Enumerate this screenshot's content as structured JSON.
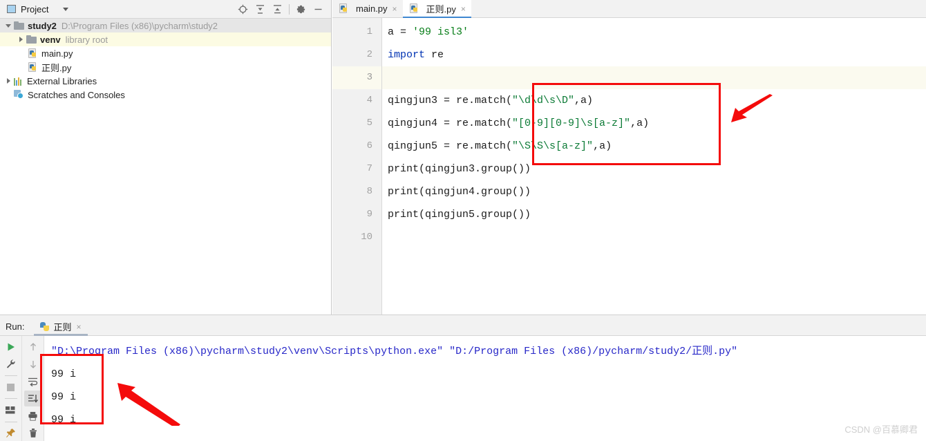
{
  "project_panel": {
    "title": "Project",
    "dropdown_icon": "chevron-down-icon",
    "tools": [
      {
        "name": "locate-icon",
        "label": "⊕"
      },
      {
        "name": "expand-all-icon",
        "label": "≡"
      },
      {
        "name": "collapse-all-icon",
        "label": "≡"
      },
      {
        "name": "settings-gear-icon",
        "label": "⚙"
      },
      {
        "name": "hide-icon",
        "label": "—"
      }
    ],
    "tree": [
      {
        "label": "study2",
        "detail": "D:\\Program Files (x86)\\pycharm\\study2",
        "icon": "folder-icon",
        "state": "expanded",
        "selected": "grey",
        "depth": 1
      },
      {
        "label": "venv",
        "detail": "library root",
        "icon": "folder-icon",
        "state": "collapsed",
        "selected": "yellow",
        "depth": 2
      },
      {
        "label": "main.py",
        "detail": "",
        "icon": "python-file-icon",
        "state": "leaf",
        "selected": "none",
        "depth": 3
      },
      {
        "label": "正则.py",
        "detail": "",
        "icon": "python-file-icon",
        "state": "leaf",
        "selected": "none",
        "depth": 3
      },
      {
        "label": "External Libraries",
        "detail": "",
        "icon": "libraries-icon",
        "state": "collapsed",
        "selected": "none",
        "depth": 1
      },
      {
        "label": "Scratches and Consoles",
        "detail": "",
        "icon": "scratches-icon",
        "state": "leaf",
        "selected": "none",
        "depth": 1
      }
    ]
  },
  "editor": {
    "tabs": [
      {
        "label": "main.py",
        "icon": "python-file-icon",
        "active": false,
        "close": "×"
      },
      {
        "label": "正则.py",
        "icon": "python-file-icon",
        "active": true,
        "close": "×"
      }
    ],
    "line_numbers": [
      "1",
      "2",
      "3",
      "4",
      "5",
      "6",
      "7",
      "8",
      "9",
      "10"
    ],
    "current_line": 3,
    "lines": [
      [
        {
          "t": "a = ",
          "c": "plain"
        },
        {
          "t": "'99 isl3'",
          "c": "string"
        }
      ],
      [
        {
          "t": "import",
          "c": "keyword"
        },
        {
          "t": " re",
          "c": "plain"
        }
      ],
      [],
      [
        {
          "t": "qingjun3 = re.match(",
          "c": "plain"
        },
        {
          "t": "\"\\d\\d\\s\\D\"",
          "c": "regex"
        },
        {
          "t": ",a)",
          "c": "plain"
        }
      ],
      [
        {
          "t": "qingjun4 = re.match(",
          "c": "plain"
        },
        {
          "t": "\"[0-9][0-9]\\s[a-z]\"",
          "c": "regex"
        },
        {
          "t": ",a)",
          "c": "plain"
        }
      ],
      [
        {
          "t": "qingjun5 = re.match(",
          "c": "plain"
        },
        {
          "t": "\"\\S\\S\\s[a-z]\"",
          "c": "regex"
        },
        {
          "t": ",a)",
          "c": "plain"
        }
      ],
      [
        {
          "t": "print(qingjun3.group())",
          "c": "plain"
        }
      ],
      [
        {
          "t": "print(qingjun4.group())",
          "c": "plain"
        }
      ],
      [
        {
          "t": "print(qingjun5.group())",
          "c": "plain"
        }
      ],
      []
    ]
  },
  "run_panel": {
    "label": "Run:",
    "tab_label": "正则",
    "tab_close": "×",
    "left_tools": [
      {
        "name": "run-icon",
        "active": false
      },
      {
        "name": "wrench-rerun-icon",
        "active": false
      },
      {
        "name": "stop-icon",
        "active": false
      },
      {
        "name": "layout-icon",
        "active": false
      },
      {
        "name": "pin-icon",
        "active": false
      }
    ],
    "second_tools": [
      {
        "name": "arrow-up-icon",
        "active": false
      },
      {
        "name": "arrow-down-icon",
        "active": false
      },
      {
        "name": "soft-wrap-icon",
        "active": false
      },
      {
        "name": "scroll-to-end-icon",
        "active": true
      },
      {
        "name": "print-icon",
        "active": false
      },
      {
        "name": "trash-icon",
        "active": false
      }
    ],
    "console": [
      {
        "text": "\"D:\\Program Files (x86)\\pycharm\\study2\\venv\\Scripts\\python.exe\" \"D:/Program Files (x86)/pycharm/study2/正则.py\"",
        "type": "command"
      },
      {
        "text": "99 i",
        "type": "output"
      },
      {
        "text": "99 i",
        "type": "output"
      },
      {
        "text": "99 i",
        "type": "output"
      }
    ]
  },
  "annotations": {
    "editor_box_color": "#f40b0b",
    "console_box_color": "#f40b0b",
    "arrow_color": "#f40b0b"
  },
  "watermark": "CSDN @百慕卿君"
}
